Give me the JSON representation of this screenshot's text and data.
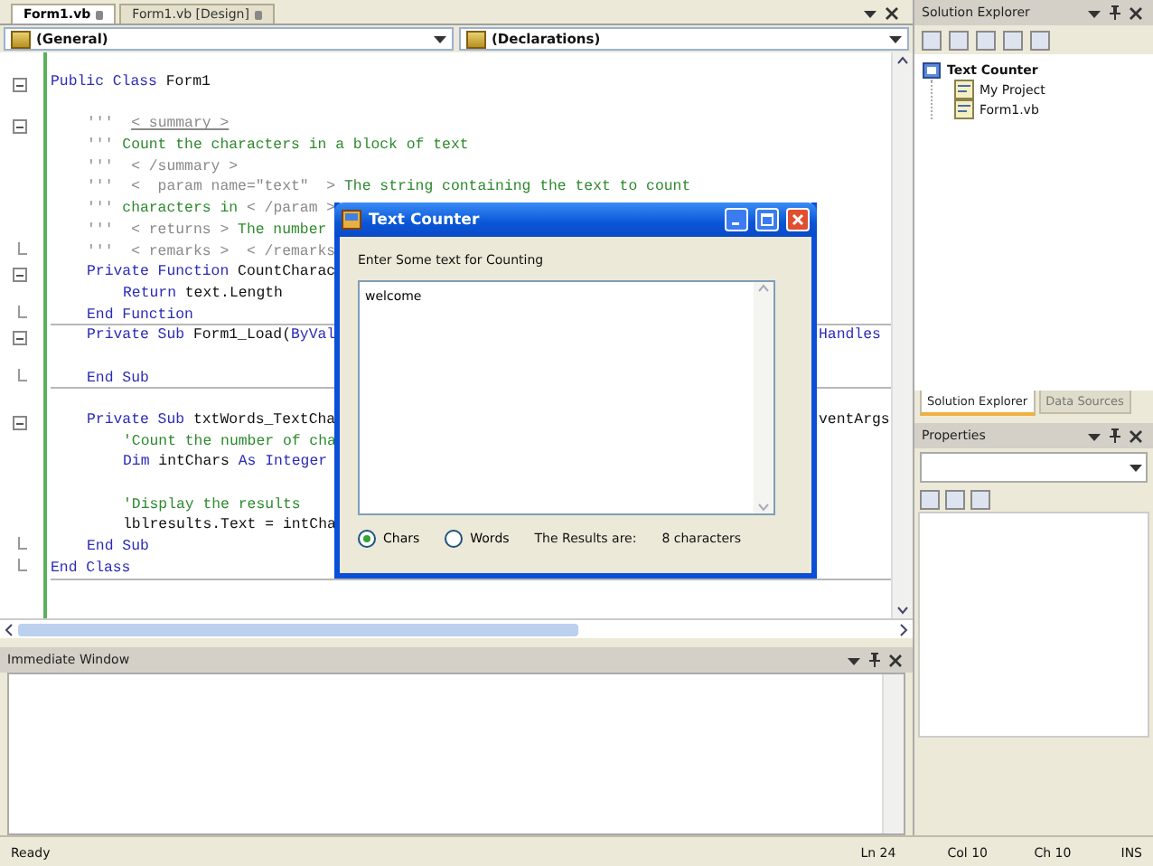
{
  "editor": {
    "tabs": [
      {
        "label": "Form1.vb",
        "selected": true
      },
      {
        "label": "Form1.vb [Design]",
        "selected": false
      }
    ],
    "object_dropdown": "(General)",
    "member_dropdown": "(Declarations)",
    "lines": [
      {
        "kind": "class",
        "collapsible": true,
        "segments": [
          {
            "kind": "keyword",
            "text": "Public Class"
          },
          {
            "kind": "plain",
            "text": " Form1"
          }
        ]
      },
      {
        "kind": "blank"
      },
      {
        "kind": "member",
        "collapsible": true,
        "segments": [
          {
            "kind": "doc",
            "text": "'''  "
          },
          {
            "kind": "doctag",
            "text": "< summary >"
          }
        ]
      },
      {
        "kind": "member",
        "segments": [
          {
            "kind": "doc",
            "text": "''' "
          },
          {
            "kind": "comment",
            "text": "Count the characters in a block of text"
          }
        ]
      },
      {
        "kind": "member",
        "segments": [
          {
            "kind": "doc",
            "text": "'''  < /summary >"
          }
        ]
      },
      {
        "kind": "member",
        "segments": [
          {
            "kind": "doc",
            "text": "'''  <  param name=\"text\"  > "
          },
          {
            "kind": "comment",
            "text": "The string containing the text to count"
          }
        ]
      },
      {
        "kind": "member",
        "segments": [
          {
            "kind": "doc",
            "text": "''' "
          },
          {
            "kind": "comment",
            "text": "characters in "
          },
          {
            "kind": "doc",
            "text": "< /param >"
          }
        ]
      },
      {
        "kind": "member",
        "segments": [
          {
            "kind": "doc",
            "text": "'''  < returns > "
          },
          {
            "kind": "comment",
            "text": "The number"
          }
        ]
      },
      {
        "kind": "member",
        "fold_end": true,
        "segments": [
          {
            "kind": "doc",
            "text": "'''  < remarks >  < /remarks"
          }
        ]
      },
      {
        "kind": "member",
        "collapsible": true,
        "segments": [
          {
            "kind": "keyword",
            "text": "Private Function"
          },
          {
            "kind": "plain",
            "text": " CountCharac"
          }
        ]
      },
      {
        "kind": "statement",
        "segments": [
          {
            "kind": "keyword",
            "text": "Return"
          },
          {
            "kind": "plain",
            "text": " text.Length"
          }
        ]
      },
      {
        "kind": "member",
        "fold_end": true,
        "rule": true,
        "segments": [
          {
            "kind": "keyword",
            "text": "End Function"
          }
        ]
      },
      {
        "kind": "member",
        "collapsible": true,
        "segments": [
          {
            "kind": "keyword",
            "text": "Private Sub"
          },
          {
            "kind": "plain",
            "text": " Form1_Load("
          },
          {
            "kind": "keyword",
            "text": "ByVal"
          }
        ],
        "tail": [
          {
            "kind": "keyword",
            "text": "Handles"
          }
        ]
      },
      {
        "kind": "blank"
      },
      {
        "kind": "member",
        "fold_end": true,
        "rule": true,
        "segments": [
          {
            "kind": "keyword",
            "text": "End Sub"
          }
        ]
      },
      {
        "kind": "blank"
      },
      {
        "kind": "member",
        "collapsible": true,
        "segments": [
          {
            "kind": "keyword",
            "text": "Private Sub"
          },
          {
            "kind": "plain",
            "text": " txtWords_TextCha"
          }
        ],
        "tail": [
          {
            "kind": "plain",
            "text": "ventArgs"
          }
        ]
      },
      {
        "kind": "statement",
        "segments": [
          {
            "kind": "comment",
            "text": "'Count the number of cha"
          }
        ]
      },
      {
        "kind": "statement",
        "segments": [
          {
            "kind": "keyword",
            "text": "Dim"
          },
          {
            "kind": "plain",
            "text": " intChars "
          },
          {
            "kind": "keyword",
            "text": "As Integer"
          }
        ]
      },
      {
        "kind": "blank"
      },
      {
        "kind": "statement",
        "segments": [
          {
            "kind": "comment",
            "text": "'Display the results"
          }
        ]
      },
      {
        "kind": "statement",
        "segments": [
          {
            "kind": "plain",
            "text": "lblresults.Text = intCha"
          }
        ]
      },
      {
        "kind": "member",
        "fold_end": true,
        "segments": [
          {
            "kind": "keyword",
            "text": "End Sub"
          }
        ]
      },
      {
        "kind": "class",
        "fold_end": true,
        "rule": true,
        "segments": [
          {
            "kind": "keyword",
            "text": "End Class"
          }
        ]
      }
    ]
  },
  "dialog": {
    "title": "Text Counter",
    "prompt": "Enter Some text for Counting",
    "value": "welcome",
    "options": [
      {
        "label": "Chars",
        "selected": true
      },
      {
        "label": "Words",
        "selected": false
      }
    ],
    "result_label": "The Results are:",
    "result": "8 characters"
  },
  "immediate_window": {
    "title": "Immediate Window"
  },
  "solution_explorer": {
    "title": "Solution Explorer",
    "tree": [
      {
        "label": "Text Counter",
        "children": [
          {
            "label": "My Project"
          },
          {
            "label": "Form1.vb"
          }
        ]
      }
    ],
    "tabs": [
      {
        "label": "Solution Explorer",
        "selected": true
      },
      {
        "label": "Data Sources",
        "selected": false
      }
    ]
  },
  "properties": {
    "title": "Properties"
  },
  "status_bar": {
    "message": "Ready",
    "line": "Ln 24",
    "column": "Col 10",
    "char": "Ch 10",
    "mode": "INS"
  }
}
